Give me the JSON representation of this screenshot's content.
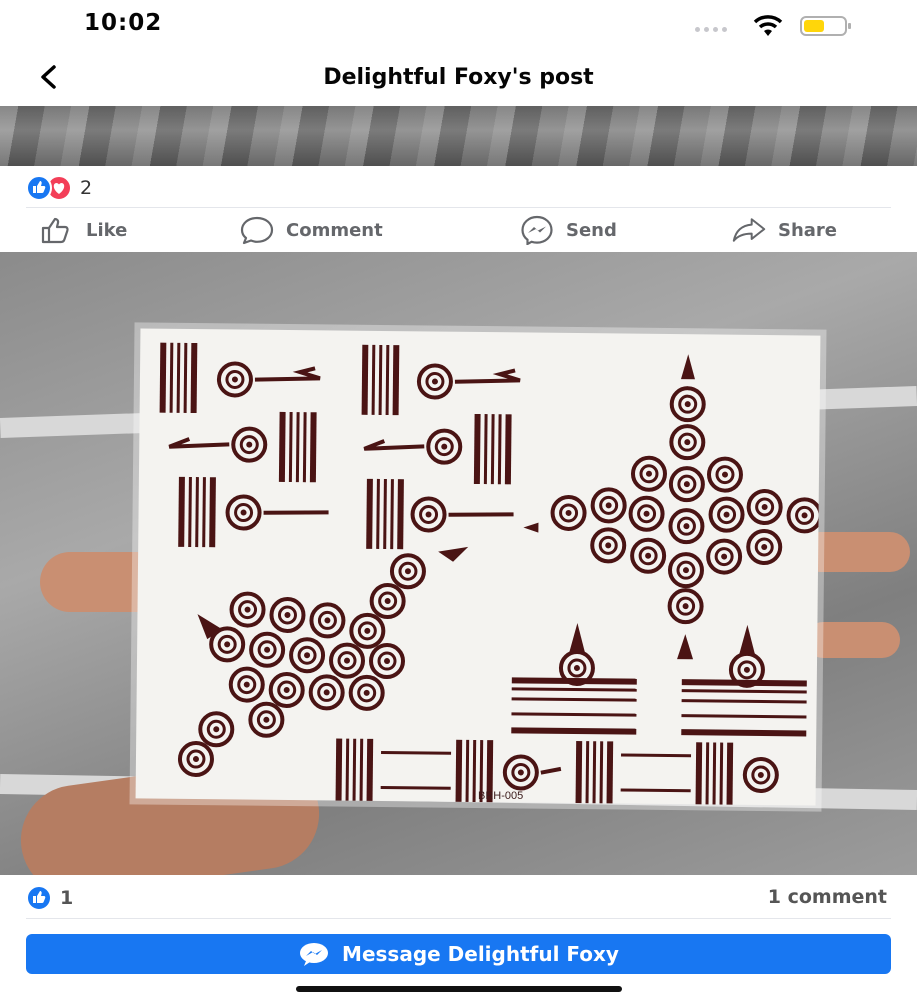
{
  "status_bar": {
    "time": "10:02",
    "icons": [
      "signal-icon",
      "wifi-icon",
      "battery-icon"
    ],
    "battery_color": "#ffd60a"
  },
  "header": {
    "title": "Delightful Foxy's post",
    "back_icon": "chevron-left-icon"
  },
  "post": {
    "top_reactions": {
      "count": "2",
      "types": [
        "like",
        "love"
      ]
    },
    "actions": [
      {
        "label": "Like",
        "icon": "thumbs-up-icon"
      },
      {
        "label": "Comment",
        "icon": "comment-icon"
      },
      {
        "label": "Send",
        "icon": "messenger-icon"
      },
      {
        "label": "Share",
        "icon": "share-icon"
      }
    ],
    "photo": {
      "card_code": "BRH-005"
    },
    "bottom_reactions": {
      "count": "1"
    },
    "comments_label": "1 comment"
  },
  "message_button": {
    "label": "Message Delightful Foxy",
    "icon": "messenger-icon"
  },
  "colors": {
    "brand": "#1877f2",
    "love": "#f33e58",
    "action_text": "#65676b",
    "henna": "#4a1414"
  }
}
